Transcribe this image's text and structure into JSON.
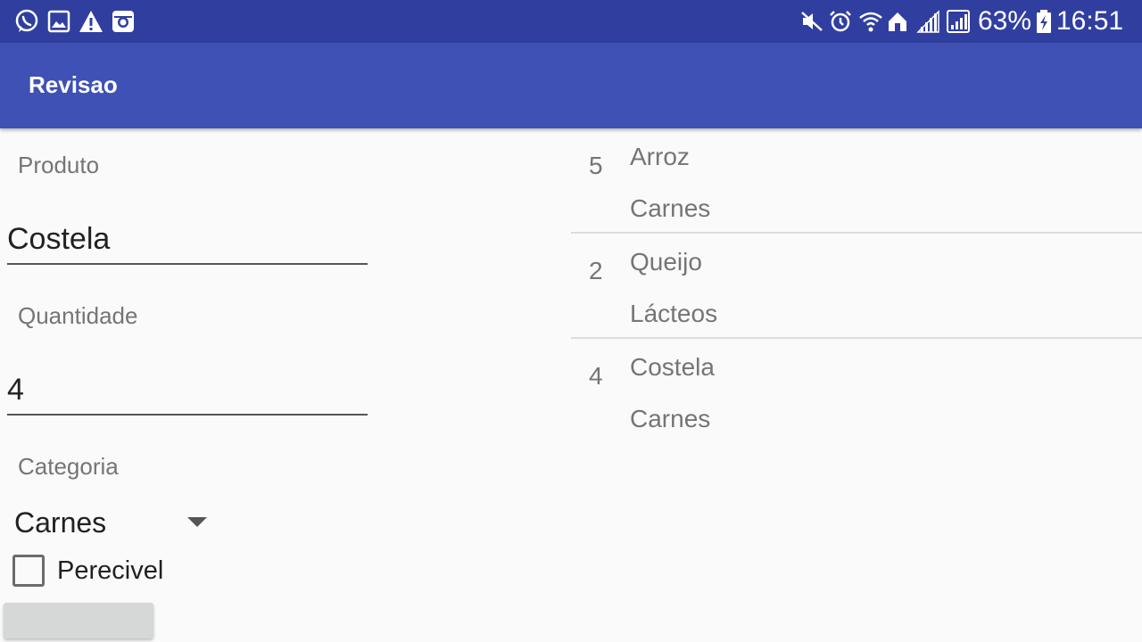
{
  "status_bar": {
    "left_icons": [
      "whatsapp-icon",
      "gallery-icon",
      "warning-icon",
      "instagram-icon"
    ],
    "right_icons": [
      "mute-icon",
      "alarm-icon",
      "wifi-icon",
      "home-network-icon",
      "signal-icon",
      "signal-icon"
    ],
    "battery_percent": "63%",
    "time": "16:51"
  },
  "app_bar": {
    "title": "Revisao"
  },
  "form": {
    "produto_label": "Produto",
    "produto_value": "Costela",
    "quantidade_label": "Quantidade",
    "quantidade_value": "4",
    "categoria_label": "Categoria",
    "categoria_value": "Carnes",
    "perecivel_label": "Perecivel",
    "perecivel_checked": false,
    "button_label": ""
  },
  "list": {
    "items": [
      {
        "quantity": "5",
        "name": "Arroz",
        "category": "Carnes"
      },
      {
        "quantity": "2",
        "name": "Queijo",
        "category": "Lácteos"
      },
      {
        "quantity": "4",
        "name": "Costela",
        "category": "Carnes"
      }
    ]
  },
  "colors": {
    "status_bar": "#303f9f",
    "app_bar": "#3f51b5",
    "background": "#fafafa"
  }
}
